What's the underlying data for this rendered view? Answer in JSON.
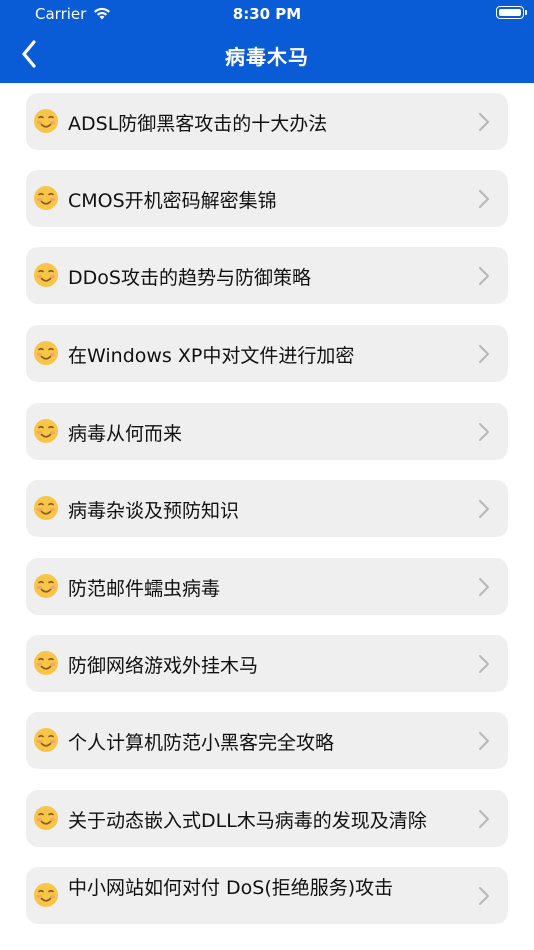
{
  "status_bar": {
    "carrier": "Carrier",
    "time": "8:30 PM"
  },
  "nav": {
    "title": "病毒木马",
    "back_icon": "chevron-left-icon"
  },
  "colors": {
    "nav_background": "#0a5bd6",
    "row_background": "#efefef",
    "chevron": "#b9b9b9"
  },
  "items": [
    {
      "label": "ADSL防御黑客攻击的十大办法",
      "icon": "smiling-face-emoji"
    },
    {
      "label": "CMOS开机密码解密集锦",
      "icon": "smiling-face-emoji"
    },
    {
      "label": "DDoS攻击的趋势与防御策略",
      "icon": "smiling-face-emoji"
    },
    {
      "label": "在Windows XP中对文件进行加密",
      "icon": "smiling-face-emoji"
    },
    {
      "label": "病毒从何而来",
      "icon": "smiling-face-emoji"
    },
    {
      "label": "病毒杂谈及预防知识",
      "icon": "smiling-face-emoji"
    },
    {
      "label": "防范邮件蠕虫病毒",
      "icon": "smiling-face-emoji"
    },
    {
      "label": "防御网络游戏外挂木马",
      "icon": "smiling-face-emoji"
    },
    {
      "label": "个人计算机防范小黑客完全攻略",
      "icon": "smiling-face-emoji"
    },
    {
      "label": "关于动态嵌入式DLL木马病毒的发现及清除",
      "icon": "smiling-face-emoji"
    },
    {
      "label": "中小网站如何对付 DoS(拒绝服务)攻击",
      "icon": "smiling-face-emoji"
    }
  ]
}
